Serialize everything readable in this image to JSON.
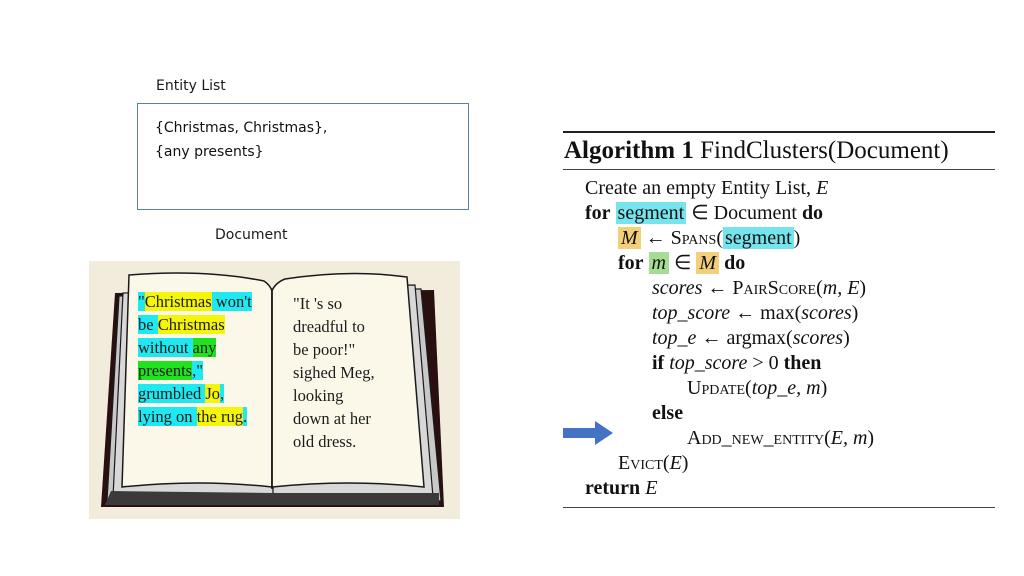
{
  "entity_list": {
    "label": "Entity List",
    "lines": [
      "{Christmas, Christmas},",
      "{any presents}"
    ]
  },
  "document": {
    "label": "Document",
    "left_page": [
      [
        {
          "t": "\"",
          "hl": "c"
        },
        {
          "t": "Christmas",
          "hl": "y"
        },
        {
          "t": " won't",
          "hl": "c"
        }
      ],
      [
        {
          "t": "be ",
          "hl": "c"
        },
        {
          "t": "Christmas",
          "hl": "y"
        },
        {
          "t": " ",
          "hl": "c"
        }
      ],
      [
        {
          "t": "without ",
          "hl": "c"
        },
        {
          "t": "any",
          "hl": "g"
        }
      ],
      [
        {
          "t": "presents",
          "hl": "g"
        },
        {
          "t": ",\"",
          "hl": "c"
        }
      ],
      [
        {
          "t": "grumbled ",
          "hl": "c"
        },
        {
          "t": "Jo",
          "hl": "y"
        },
        {
          "t": ",",
          "hl": "c"
        }
      ],
      [
        {
          "t": "lying on ",
          "hl": "c"
        },
        {
          "t": "the rug",
          "hl": "y"
        },
        {
          "t": ".",
          "hl": "c"
        }
      ]
    ],
    "right_page": [
      "\"It 's so",
      "dreadful to",
      "be poor!\"",
      "sighed Meg,",
      "looking",
      "down at her",
      "old dress."
    ]
  },
  "highlight_colors": {
    "segment_cyan": "#1ee8f2",
    "mention_yellow": "#f5f50a",
    "current_green": "#1fe31f",
    "arrow_blue": "#4472c4"
  },
  "algorithm": {
    "title_bold": "Algorithm 1",
    "title_rest": "FindClusters(Document)",
    "line1_text": "Create an empty Entity List, ",
    "line1_var": "E",
    "for_kw": "for",
    "segment": "segment",
    "elem_in_document": " ∈ Document ",
    "do_kw": "do",
    "M": "M",
    "assign": " ← ",
    "spans": "Spans",
    "paren_open": "(",
    "paren_close": ")",
    "m": "m",
    "elem": " ∈ ",
    "scores": "scores",
    "pairscore": "PairScore",
    "pairscore_args": "m, E",
    "top_score": "top_score",
    "max": "max",
    "top_e": "top_e",
    "argmax": "argmax",
    "if_kw": "if",
    "gt_zero": " > 0 ",
    "then_kw": "then",
    "update": "Update",
    "update_args": "top_e, m",
    "else_kw": "else",
    "add_new_entity": "Add_new_entity",
    "add_args": "E, m",
    "evict": "Evict",
    "evict_arg": "E",
    "return_kw": "return",
    "return_var": "E"
  },
  "pointer": {
    "icon": "right-arrow-icon",
    "points_to": "Add_new_entity"
  }
}
